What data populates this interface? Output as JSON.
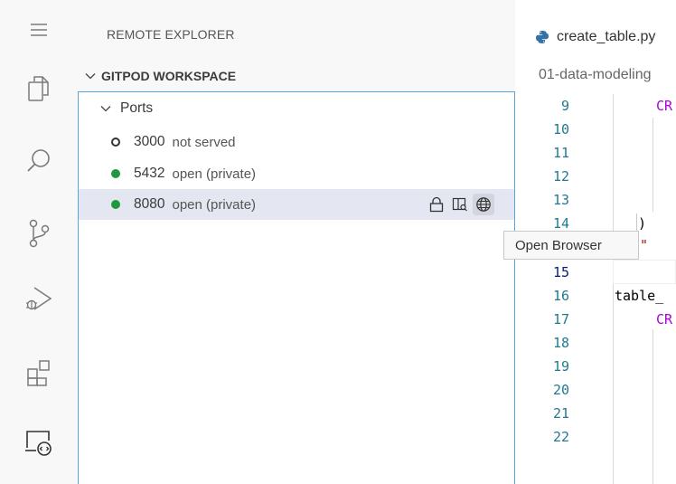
{
  "activity_bar": {
    "items": [
      {
        "icon": "menu-icon"
      },
      {
        "icon": "explorer-icon"
      },
      {
        "icon": "search-icon"
      },
      {
        "icon": "source-control-icon"
      },
      {
        "icon": "run-debug-icon"
      },
      {
        "icon": "extensions-icon"
      },
      {
        "icon": "remote-explorer-icon",
        "active": true
      }
    ]
  },
  "sidebar": {
    "title": "REMOTE EXPLORER",
    "workspace_header": "GITPOD WORKSPACE",
    "tree": {
      "ports_label": "Ports",
      "ports": [
        {
          "number": "3000",
          "status": "not served",
          "state": "not-served"
        },
        {
          "number": "5432",
          "status": "open (private)",
          "state": "open"
        },
        {
          "number": "8080",
          "status": "open (private)",
          "state": "open",
          "selected": true
        }
      ],
      "row_actions": [
        "lock-icon",
        "preview-icon",
        "globe-icon"
      ]
    }
  },
  "editor": {
    "tab_label": "create_table.py",
    "breadcrumb": "01-data-modeling",
    "line_numbers": [
      "9",
      "10",
      "11",
      "12",
      "13",
      "14",
      "15",
      "16",
      "17",
      "18",
      "19",
      "20",
      "21",
      "22"
    ],
    "code": {
      "line9": "CR",
      "line13": ")",
      "line14": "\"",
      "line16": "table_",
      "line17": "CR"
    }
  },
  "tooltip": {
    "text": "Open Browser"
  },
  "colors": {
    "focus_border": "#5ba5dd",
    "open_port": "#1e9a3c",
    "line_number": "#237893"
  }
}
